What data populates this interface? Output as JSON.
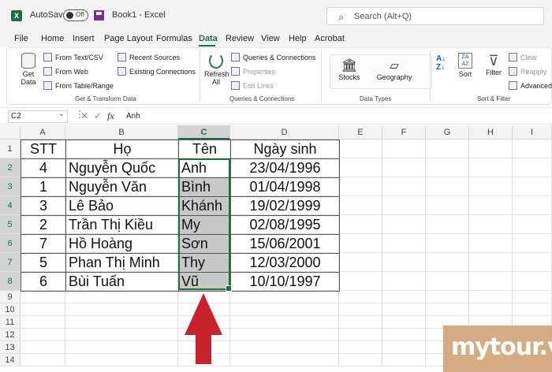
{
  "title_bar": {
    "app_letter": "X",
    "autosave_label": "AutoSave",
    "autosave_state": "Off",
    "document_title": "Book1  -  Excel",
    "search_placeholder": "Search (Alt+Q)"
  },
  "menu": {
    "items": [
      "File",
      "Home",
      "Insert",
      "Page Layout",
      "Formulas",
      "Data",
      "Review",
      "View",
      "Help",
      "Acrobat"
    ],
    "active": "Data"
  },
  "ribbon": {
    "get_transform": {
      "get_data": "Get",
      "get_data_2": "Data",
      "from_text": "From Text/CSV",
      "from_web": "From Web",
      "from_table": "From Table/Range",
      "recent_sources": "Recent Sources",
      "existing_connections": "Existing Connections",
      "label": "Get & Transform Data"
    },
    "queries": {
      "refresh": "Refresh",
      "refresh_2": "All",
      "queries_connections": "Queries & Connections",
      "properties": "Properties",
      "edit_links": "Edit Links",
      "label": "Queries & Connections"
    },
    "data_types": {
      "stocks": "Stocks",
      "geography": "Geography",
      "label": "Data Types"
    },
    "sort_filter": {
      "sort": "Sort",
      "filter": "Filter",
      "clear": "Clear",
      "reapply": "Reapply",
      "advanced": "Advanced",
      "label": "Sort & Filter"
    }
  },
  "formula_bar": {
    "name_box": "C2",
    "cancel_symbol": "✕",
    "enter_symbol": "✓",
    "fx_symbol": "fx",
    "value": "Anh"
  },
  "sheet": {
    "columns": [
      "A",
      "B",
      "C",
      "D",
      "E",
      "F",
      "G",
      "H",
      "I"
    ],
    "rows": [
      "1",
      "2",
      "3",
      "4",
      "5",
      "6",
      "7",
      "8",
      "9",
      "10",
      "11",
      "12",
      "13",
      "14"
    ],
    "headers": [
      "STT",
      "Họ",
      "Tên",
      "Ngày sinh"
    ],
    "data": [
      [
        "4",
        "Nguyễn Quốc",
        "Anh",
        "23/04/1996"
      ],
      [
        "1",
        "Nguyễn Văn",
        "Bình",
        "01/04/1998"
      ],
      [
        "3",
        "Lê Bảo",
        "Khánh",
        "19/02/1999"
      ],
      [
        "2",
        "Trần Thị Kiều",
        "My",
        "02/08/1995"
      ],
      [
        "7",
        "Hồ Hoàng",
        "Sơn",
        "15/06/2001"
      ],
      [
        "5",
        "Phan Thị Minh",
        "Thy",
        "12/03/2000"
      ],
      [
        "6",
        "Bùi Tuấn",
        "Vũ",
        "10/10/1997"
      ]
    ],
    "selected_range": "C2:C8",
    "selection_color": "#1d6f42"
  },
  "watermark": {
    "text": "mytour.vn"
  },
  "arrow_color": "#c8232c"
}
